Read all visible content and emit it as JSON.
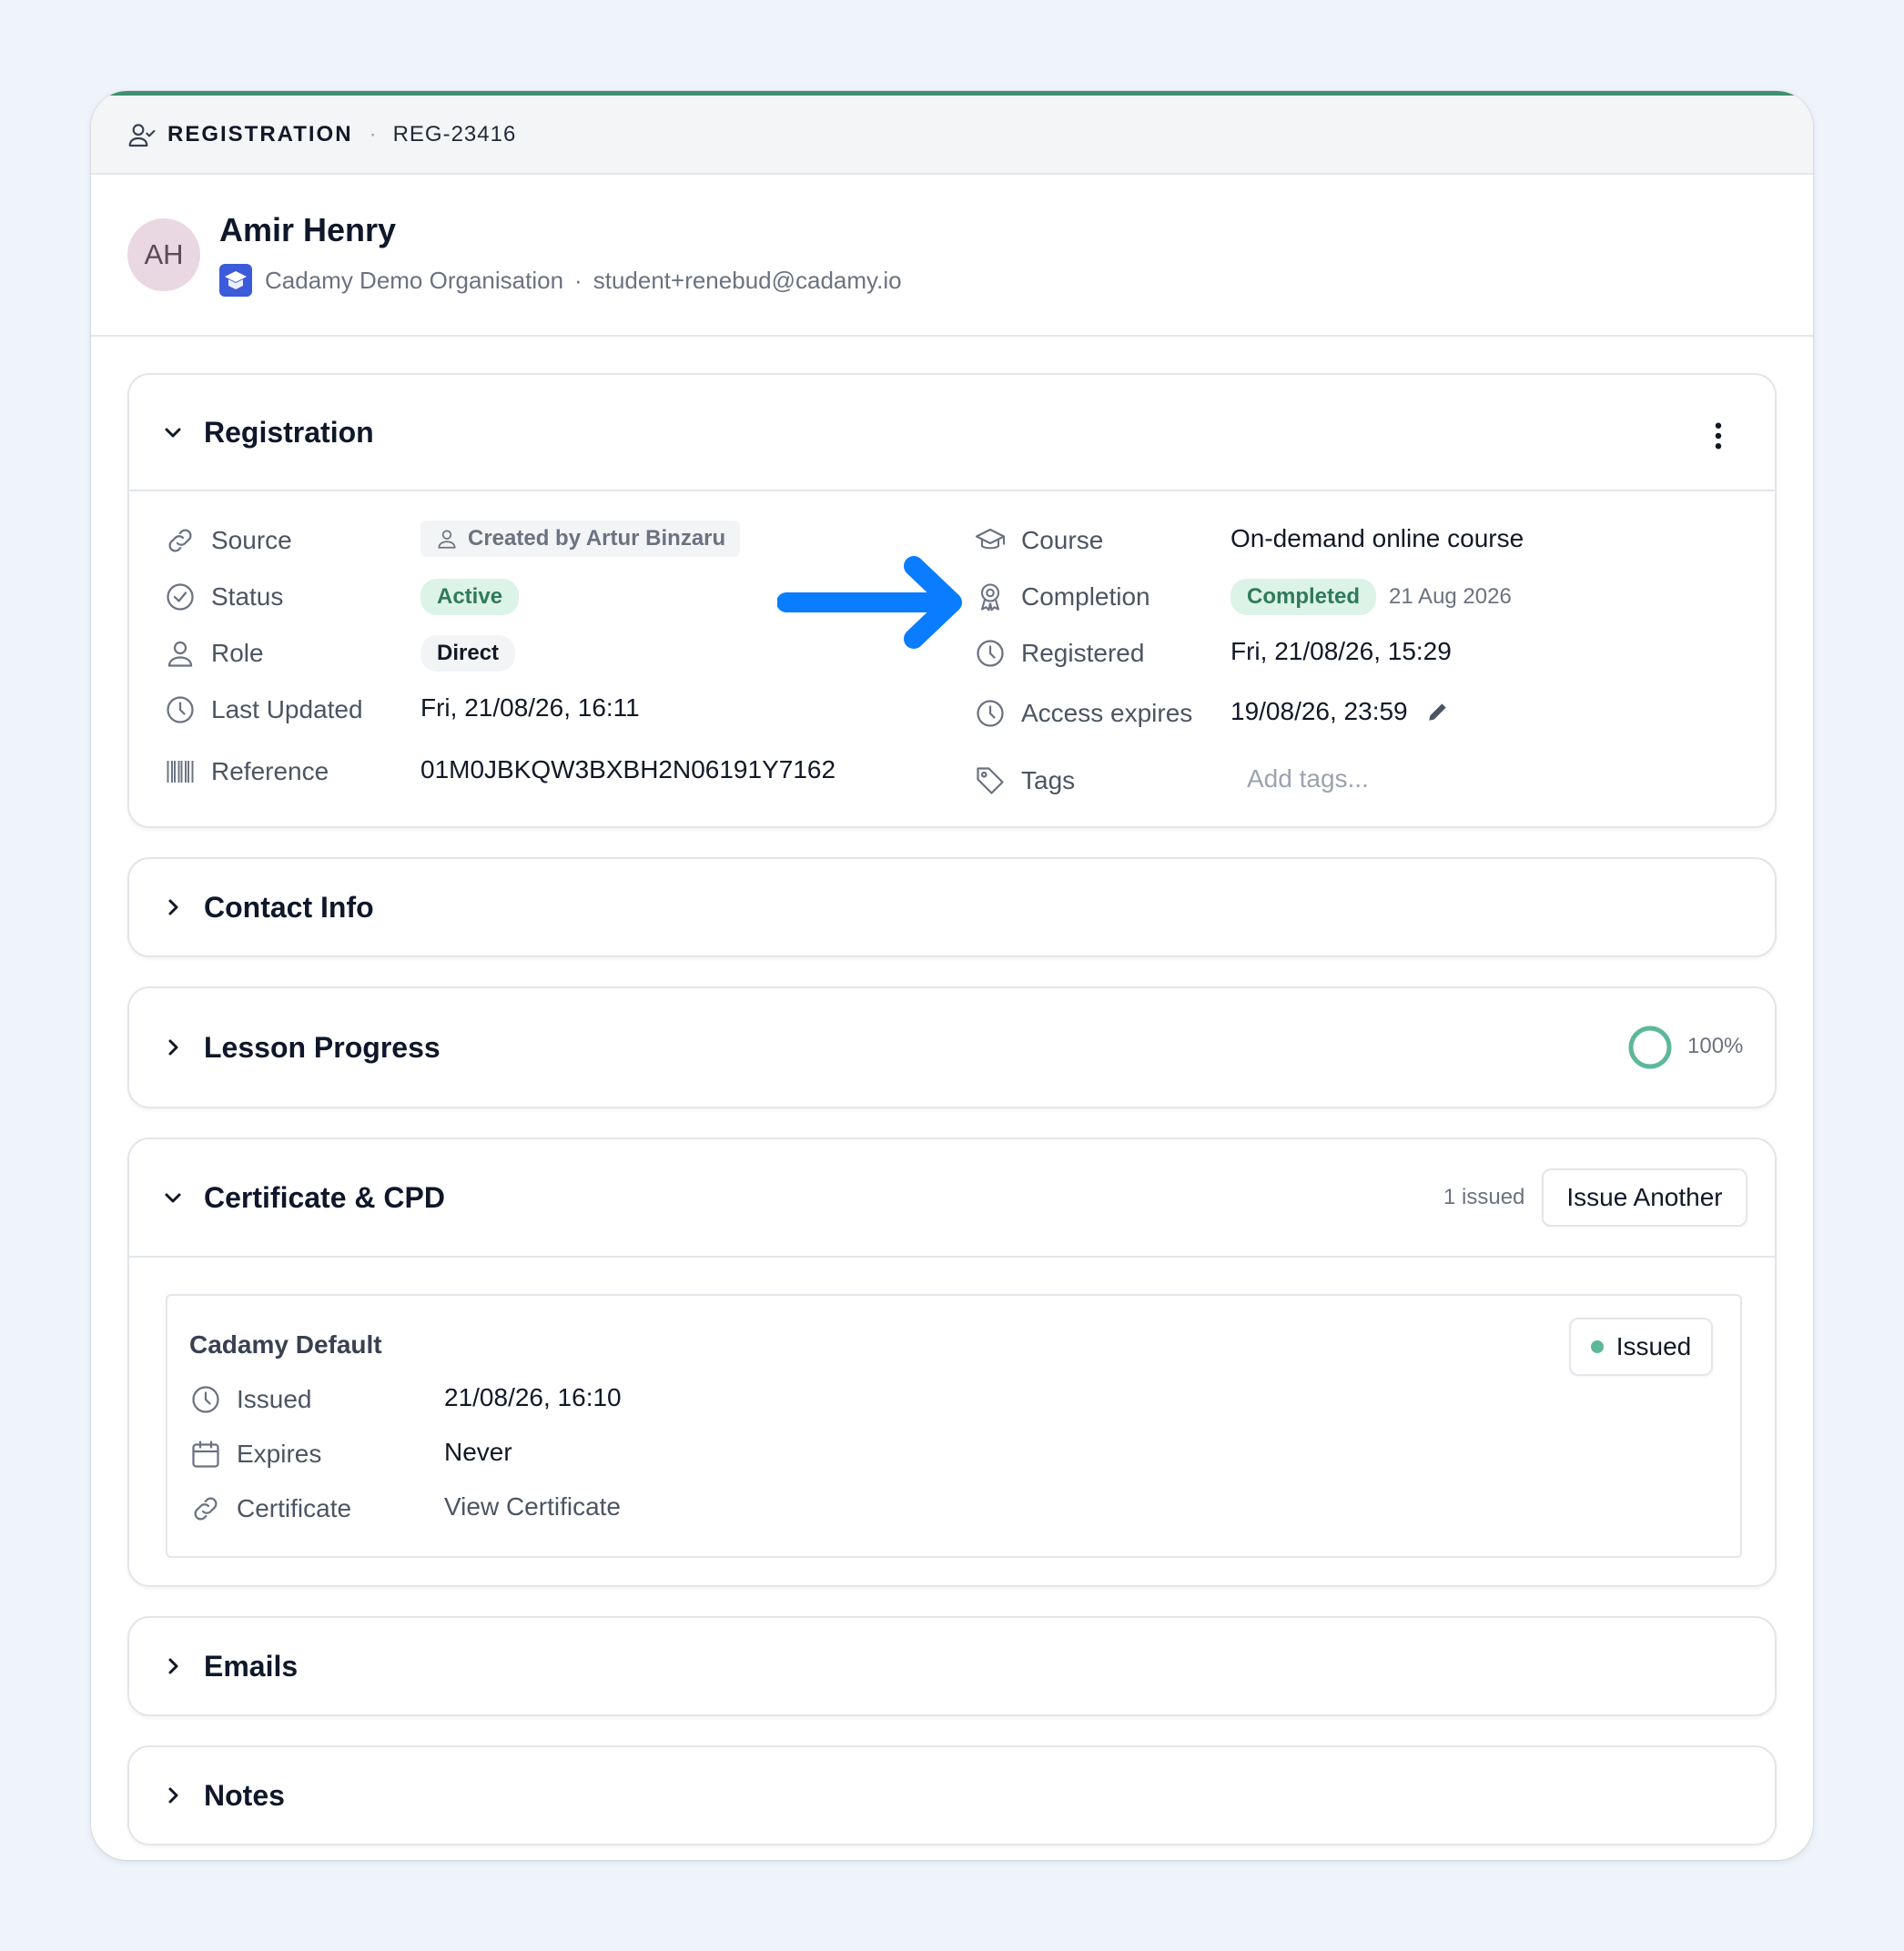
{
  "header": {
    "label": "REGISTRATION",
    "separator": "·",
    "id": "REG-23416"
  },
  "profile": {
    "initials": "AH",
    "name": "Amir Henry",
    "organisation": "Cadamy Demo Organisation",
    "separator": "·",
    "email": "student+renebud@cadamy.io"
  },
  "registration": {
    "title": "Registration",
    "left": {
      "source_label": "Source",
      "source_value": "Created by Artur Binzaru",
      "status_label": "Status",
      "status_value": "Active",
      "role_label": "Role",
      "role_value": "Direct",
      "updated_label": "Last Updated",
      "updated_value": "Fri, 21/08/26, 16:11",
      "reference_label": "Reference",
      "reference_value": "01M0JBKQW3BXBH2N06191Y7162"
    },
    "right": {
      "course_label": "Course",
      "course_value": "On-demand online course",
      "completion_label": "Completion",
      "completion_value": "Completed",
      "completion_date": "21 Aug 2026",
      "registered_label": "Registered",
      "registered_value": "Fri, 21/08/26, 15:29",
      "expires_label": "Access expires",
      "expires_value": "19/08/26, 23:59",
      "tags_label": "Tags",
      "tags_placeholder": "Add tags..."
    }
  },
  "contact": {
    "title": "Contact Info"
  },
  "lesson": {
    "title": "Lesson Progress",
    "progress_text": "100%",
    "progress_fraction": 1.0
  },
  "certificate": {
    "title": "Certificate & CPD",
    "issued_count": "1 issued",
    "issue_button": "Issue Another",
    "item": {
      "name": "Cadamy Default",
      "status": "Issued",
      "issued_label": "Issued",
      "issued_value": "21/08/26, 16:10",
      "expires_label": "Expires",
      "expires_value": "Never",
      "certificate_label": "Certificate",
      "certificate_value": "View Certificate"
    }
  },
  "emails": {
    "title": "Emails"
  },
  "notes": {
    "title": "Notes"
  },
  "colors": {
    "accent_green": "#3f8f6e",
    "arrow_blue": "#0a7cff",
    "progress_ring": "#5db89a"
  }
}
